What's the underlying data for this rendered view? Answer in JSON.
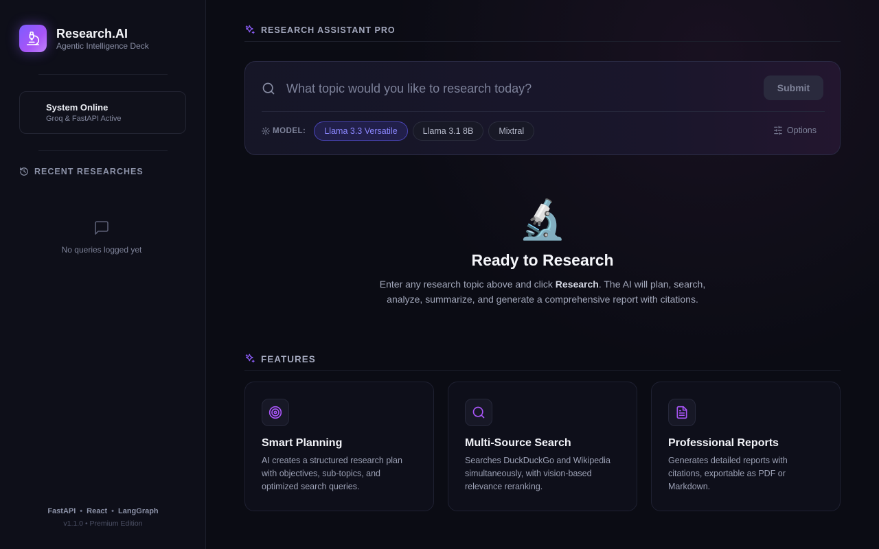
{
  "sidebar": {
    "brand_title": "Research.AI",
    "brand_subtitle": "Agentic Intelligence Deck",
    "status_title": "System Online",
    "status_subtitle": "Groq & FastAPI Active",
    "recent_heading": "RECENT RESEARCHES",
    "empty_text": "No queries logged yet",
    "footer_links": [
      "FastAPI",
      "React",
      "LangGraph"
    ],
    "footer_version": "v1.1.0 • Premium Edition"
  },
  "main": {
    "section_title": "RESEARCH ASSISTANT PRO",
    "search": {
      "placeholder": "What topic would you like to research today?",
      "value": "",
      "submit_label": "Submit"
    },
    "model_label": "MODEL:",
    "models": [
      "Llama 3.3 Versatile",
      "Llama 3.1 8B",
      "Mixtral"
    ],
    "selected_model": "Llama 3.3 Versatile",
    "options_label": "Options",
    "hero": {
      "emoji": "🔬",
      "title": "Ready to Research",
      "desc_before": "Enter any research topic above and click ",
      "desc_bold": "Research",
      "desc_after": ". The AI will plan, search, analyze, summarize, and generate a comprehensive report with citations."
    },
    "features_title": "FEATURES",
    "features": [
      {
        "icon": "target-icon",
        "title": "Smart Planning",
        "desc": "AI creates a structured research plan with objectives, sub-topics, and optimized search queries."
      },
      {
        "icon": "search-icon",
        "title": "Multi-Source Search",
        "desc": "Searches DuckDuckGo and Wikipedia simultaneously, with vision-based relevance reranking."
      },
      {
        "icon": "document-icon",
        "title": "Professional Reports",
        "desc": "Generates detailed reports with citations, exportable as PDF or Markdown."
      }
    ]
  },
  "colors": {
    "accent": "#8b5cf6",
    "active_pill_text": "#8b87ff",
    "background": "#0b0c14"
  }
}
